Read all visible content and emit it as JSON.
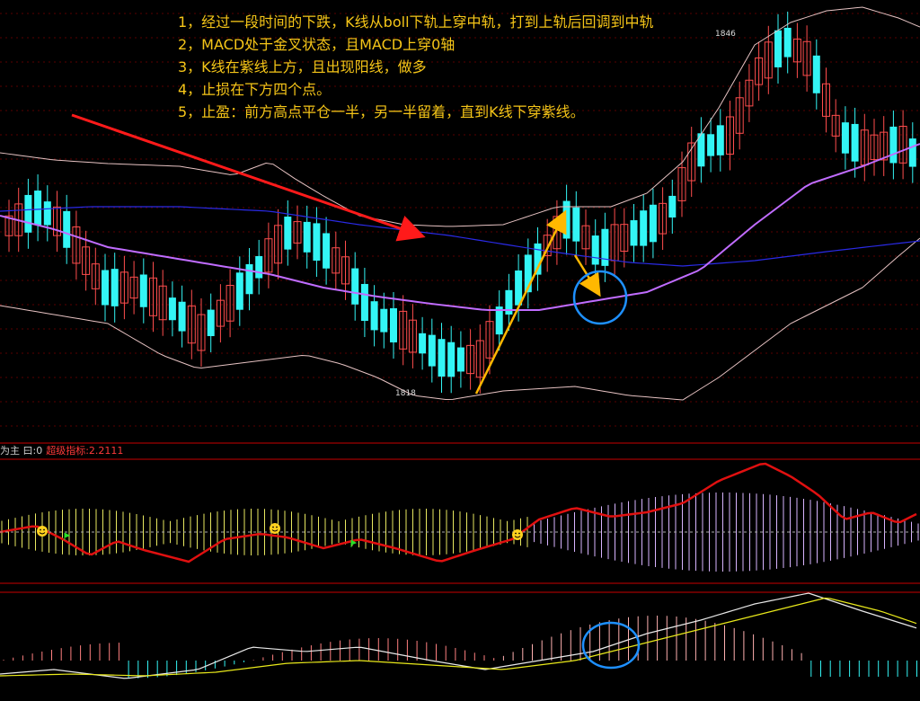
{
  "notes": [
    "1，经过一段时间的下跌，K线从boll下轨上穿中轨，打到上轨后回调到中轨",
    "2，MACD处于金叉状态，且MACD上穿0轴",
    "3，K线在紫线上方，且出现阳线，做多",
    "4，止损在下方四个点。",
    "5，止盈：前方高点平仓一半，另一半留着，直到K线下穿紫线。"
  ],
  "price_labels": {
    "high": "1846",
    "low": "1818"
  },
  "indicator_bar": {
    "label": "为主 曰:0",
    "value": "超级指标:2.2111"
  },
  "colors": {
    "background": "#000000",
    "up_candle": "#ff4d4d",
    "down_candle": "#33f5f5",
    "boll_band": "#e6c2c2",
    "boll_mid": "#2020e0",
    "purple_line": "#c06cff",
    "annotation_arrow_red": "#ff1a1a",
    "annotation_arrow_yellow": "#ffb800",
    "circle": "#1e90ff",
    "text_yellow": "#f5c518"
  },
  "icons": [
    "smiley-icon",
    "green-flag-icon"
  ]
}
